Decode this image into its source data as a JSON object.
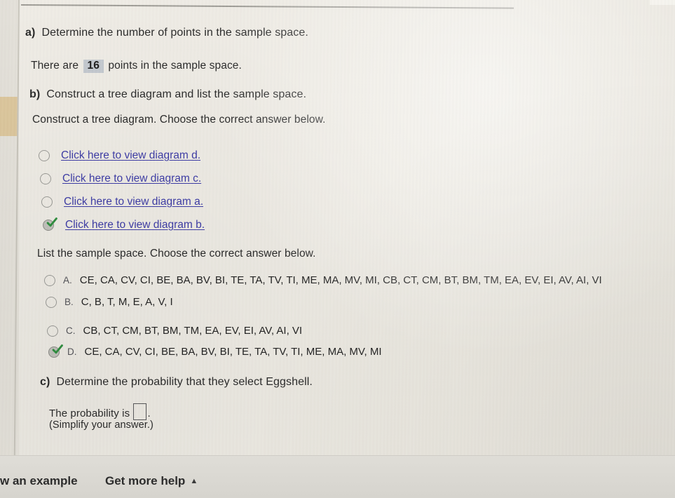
{
  "problem": {
    "part_a_prompt": "a) Determine the number of points in the sample space.",
    "part_a_label_prefix": "There are",
    "part_a_answer_value": "16",
    "part_a_label_suffix": "points in the sample space.",
    "part_b_prompt": "b) Construct a tree diagram and list the sample space.",
    "tree_instruction": "Construct a tree diagram. Choose the correct answer below.",
    "list_instruction": "List the sample space. Choose the correct answer below.",
    "part_c_prompt": "c) Determine the probability that they select Eggshell.",
    "probability_label": "The probability is",
    "probability_value": "",
    "simplify_note": "(Simplify your answer.)"
  },
  "diagram_choices": [
    {
      "label": "Click here to view diagram d.",
      "selected": false
    },
    {
      "label": "Click here to view diagram c.",
      "selected": false
    },
    {
      "label": "Click here to view diagram a.",
      "selected": false
    },
    {
      "label": "Click here to view diagram b.",
      "selected": true
    }
  ],
  "sample_space_choices": [
    {
      "letter": "A.",
      "text": "CE, CA, CV, CI, BE, BA, BV, BI, TE, TA, TV, TI, ME, MA, MV, MI, CB, CT, CM, BT, BM, TM, EA, EV, EI, AV, AI, VI",
      "selected": false
    },
    {
      "letter": "B.",
      "text": "C, B, T, M, E, A, V, I",
      "selected": false
    },
    {
      "letter": "C.",
      "text": "CB, CT, CM, BT, BM, TM, EA, EV, EI, AV, AI, VI",
      "selected": false
    },
    {
      "letter": "D.",
      "text": "CE, CA, CV, CI, BE, BA, BV, BI, TE, TA, TV, TI, ME, MA, MV, MI",
      "selected": true
    }
  ],
  "bottom_bar": {
    "view_example_label": "w an example",
    "get_more_help_label": "Get more help",
    "get_more_help_caret": "▲"
  },
  "colors": {
    "link": "#3d3ca6",
    "check": "#2f8f3f",
    "answer_box_fill": "#c4c9cf",
    "tan_block": "#dcc79d",
    "page_background": "#eeebe4"
  }
}
